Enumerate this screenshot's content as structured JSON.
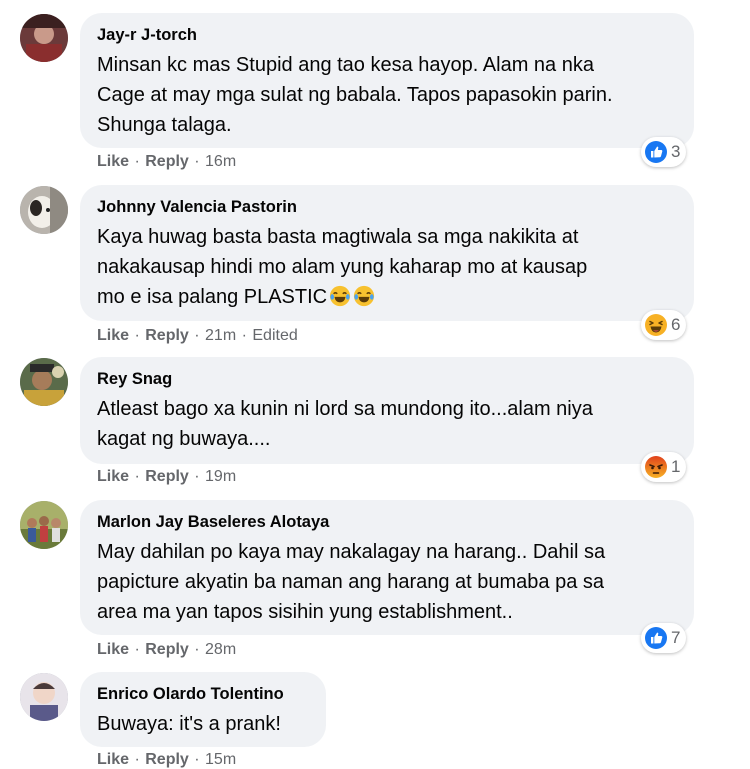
{
  "comments": [
    {
      "author": "Jay-r J-torch",
      "text": "Minsan kc mas Stupid ang tao kesa hayop. Alam na nka\nCage at may mga sulat ng babala. Tapos papasokin parin.\nShunga talaga.",
      "like": "Like",
      "reply": "Reply",
      "time": "16m",
      "edited": "",
      "reaction": "like-icon",
      "reaction_count": "3"
    },
    {
      "author": "Johnny Valencia Pastorin",
      "text": "Kaya huwag basta basta magtiwala sa mga nakikita at\nnakakausap hindi mo alam yung kaharap mo at kausap\nmo e isa palang PLASTIC",
      "like": "Like",
      "reply": "Reply",
      "time": "21m",
      "edited": "Edited",
      "reaction": "haha-icon",
      "reaction_count": "6"
    },
    {
      "author": "Rey Snag",
      "text": "Atleast bago xa kunin ni lord sa mundong ito...alam niya\nkagat ng buwaya....",
      "like": "Like",
      "reply": "Reply",
      "time": "19m",
      "edited": "",
      "reaction": "angry-icon",
      "reaction_count": "1"
    },
    {
      "author": "Marlon Jay Baseleres Alotaya",
      "text": "May dahilan po kaya may nakalagay na harang.. Dahil sa\npapicture akyatin ba naman ang harang at bumaba pa sa\narea ma yan tapos sisihin yung establishment..",
      "like": "Like",
      "reply": "Reply",
      "time": "28m",
      "edited": "",
      "reaction": "like-icon",
      "reaction_count": "7"
    },
    {
      "author": "Enrico Olardo Tolentino",
      "text": "Buwaya: it's a prank!",
      "like": "Like",
      "reply": "Reply",
      "time": "15m",
      "edited": "",
      "reaction": "",
      "reaction_count": ""
    }
  ],
  "colors": {
    "bubble": "#f0f2f5",
    "meta_text": "#65676b",
    "like_blue": "#1877f2",
    "haha_yellow": "#f7b125",
    "angry_red": "#e9710f"
  }
}
